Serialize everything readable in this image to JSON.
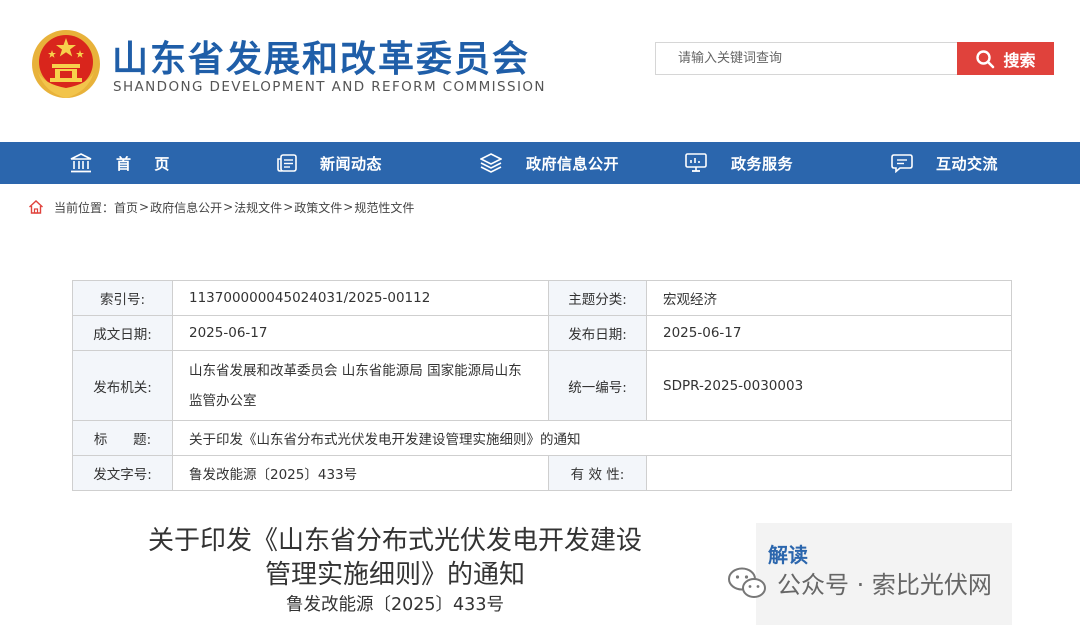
{
  "header": {
    "title": "山东省发展和改革委员会",
    "subtitle": "SHANDONG DEVELOPMENT AND REFORM COMMISSION",
    "search_placeholder": "请输入关键词查询",
    "search_label": "搜索"
  },
  "nav": [
    {
      "label": "首    页",
      "icon": "government-building-icon"
    },
    {
      "label": "新闻动态",
      "icon": "news-icon"
    },
    {
      "label": "政府信息公开",
      "icon": "layers-icon"
    },
    {
      "label": "政务服务",
      "icon": "monitor-icon"
    },
    {
      "label": "互动交流",
      "icon": "chat-icon"
    }
  ],
  "breadcrumb": {
    "prefix": "当前位置：",
    "items": [
      "首页",
      "政府信息公开",
      "法规文件",
      "政策文件",
      "规范性文件"
    ]
  },
  "info_table": {
    "index_label": "索引号:",
    "index_value": "113700000045024031/2025-00112",
    "topic_label": "主题分类:",
    "topic_value": "宏观经济",
    "created_label": "成文日期:",
    "created_value": "2025-06-17",
    "published_label": "发布日期:",
    "published_value": "2025-06-17",
    "issuer_label": "发布机关:",
    "issuer_value": "山东省发展和改革委员会 山东省能源局 国家能源局山东监管办公室",
    "serial_label": "统一编号:",
    "serial_value": "SDPR-2025-0030003",
    "title_label": "标      题:",
    "title_value": "关于印发《山东省分布式光伏发电开发建设管理实施细则》的通知",
    "docno_label": "发文字号:",
    "docno_value": "鲁发改能源〔2025〕433号",
    "validity_label": "有 效 性:",
    "validity_value": ""
  },
  "article": {
    "title_line1": "关于印发《山东省分布式光伏发电开发建设",
    "title_line2": "管理实施细则》的通知",
    "doc_number": "鲁发改能源〔2025〕433号"
  },
  "side_panel": {
    "title": "解读"
  },
  "watermark": {
    "text": "公众号 · 索比光伏网"
  },
  "colors": {
    "brand_blue": "#2b66ad",
    "title_blue": "#1f5ea8",
    "search_red": "#e0423c",
    "table_label_bg": "#f3f6fa"
  }
}
